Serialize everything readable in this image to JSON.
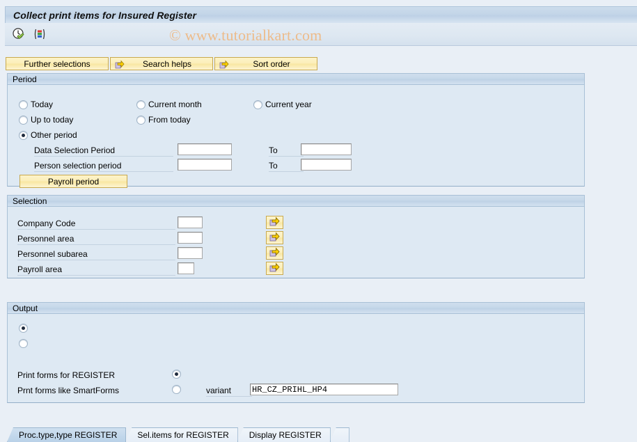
{
  "window": {
    "title": "Collect print items for Insured Register"
  },
  "watermark": {
    "text": "© www.tutorialkart.com"
  },
  "toolbar": {
    "icons": [
      {
        "name": "execute-clock-check-icon",
        "label": "Execute"
      },
      {
        "name": "variant-bars-icon",
        "label": "Get Variant"
      }
    ]
  },
  "action_buttons": [
    {
      "label": "Further selections",
      "icon": "none"
    },
    {
      "label": "Search helps",
      "icon": "arrow-right-icon"
    },
    {
      "label": "Sort order",
      "icon": "arrow-right-icon"
    }
  ],
  "period": {
    "header": "Period",
    "radios": [
      {
        "label": "Today",
        "selected": false
      },
      {
        "label": "Current month",
        "selected": false
      },
      {
        "label": "Current year",
        "selected": false
      },
      {
        "label": "Up to today",
        "selected": false
      },
      {
        "label": "From today",
        "selected": false
      },
      {
        "label": "Other period",
        "selected": true
      }
    ],
    "rows": [
      {
        "label": "Data Selection Period",
        "from_value": "",
        "to_label": "To",
        "to_value": ""
      },
      {
        "label": "Person selection period",
        "from_value": "",
        "to_label": "To",
        "to_value": ""
      }
    ],
    "payroll_period_button": "Payroll period"
  },
  "selection": {
    "header": "Selection",
    "rows": [
      {
        "label": "Company Code",
        "value": "",
        "multi_icon": "multi-select-arrow-icon"
      },
      {
        "label": "Personnel area",
        "value": "",
        "multi_icon": "multi-select-arrow-icon"
      },
      {
        "label": "Personnel subarea",
        "value": "",
        "multi_icon": "multi-select-arrow-icon"
      },
      {
        "label": "Payroll area",
        "value": "",
        "multi_icon": "multi-select-arrow-icon"
      }
    ]
  },
  "output": {
    "header": "Output",
    "top_radios": [
      {
        "label": "",
        "selected": true
      },
      {
        "label": "",
        "selected": false
      }
    ],
    "form_radios": [
      {
        "label": "Print forms for REGISTER",
        "selected": true
      },
      {
        "label": "Prnt forms like SmartForms",
        "selected": false
      }
    ],
    "variant_label": "variant",
    "variant_value": "HR_CZ_PRIHL_HP4"
  },
  "tabs": [
    {
      "label": "Proc.type,type REGISTER",
      "active": true
    },
    {
      "label": "Sel.items for REGISTER",
      "active": false
    },
    {
      "label": "Display REGISTER",
      "active": false
    },
    {
      "label": "",
      "active": false,
      "stub": true
    }
  ],
  "colors": {
    "window_bg": "#e9eff6",
    "panel_bg": "#dee9f3",
    "panel_border": "#a8c0d6",
    "button_yellow": "#fbeeb8",
    "button_border": "#c8a94e",
    "watermark": "#edbb8a",
    "tab_active": "#b9d1e8"
  }
}
